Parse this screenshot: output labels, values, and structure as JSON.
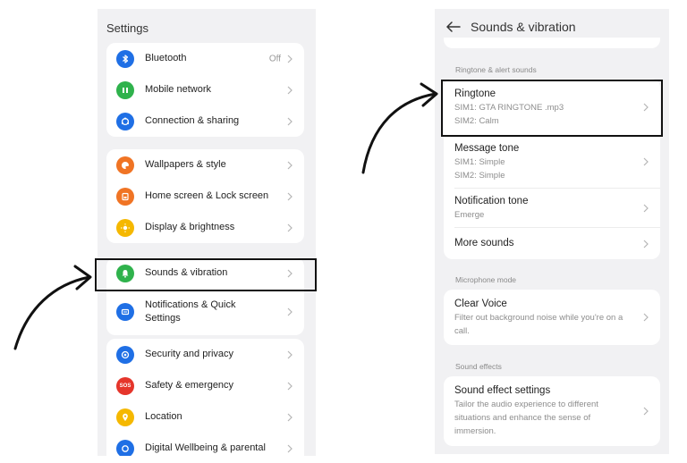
{
  "left": {
    "title": "Settings",
    "groups": [
      [
        {
          "label": "Bluetooth",
          "value": "Off",
          "icon": "bluetooth-icon",
          "color": "#1f6fe5"
        },
        {
          "label": "Mobile network",
          "icon": "signal-icon",
          "color": "#2fb24c"
        },
        {
          "label": "Connection & sharing",
          "icon": "sharing-icon",
          "color": "#1f6fe5"
        }
      ],
      [
        {
          "label": "Wallpapers & style",
          "icon": "palette-icon",
          "color": "#f07424"
        },
        {
          "label": "Home screen & Lock screen",
          "icon": "home-screen-icon",
          "color": "#f07424"
        },
        {
          "label": "Display & brightness",
          "icon": "sun-icon",
          "color": "#f5b800"
        }
      ],
      [
        {
          "label": "Sounds & vibration",
          "icon": "bell-icon",
          "color": "#2fb24c"
        },
        {
          "label": "Notifications & Quick Settings",
          "icon": "notification-icon",
          "color": "#1f6fe5"
        }
      ],
      [
        {
          "label": "Security and privacy",
          "icon": "security-icon",
          "color": "#1f6fe5"
        },
        {
          "label": "Safety & emergency",
          "icon": "sos-icon",
          "color": "#e5352b",
          "text": "SOS"
        },
        {
          "label": "Location",
          "icon": "location-pin-icon",
          "color": "#f5b800"
        },
        {
          "label": "Digital Wellbeing & parental",
          "icon": "wellbeing-icon",
          "color": "#1f6fe5"
        }
      ]
    ]
  },
  "right": {
    "title": "Sounds & vibration",
    "sections": {
      "ringtone_label": "Ringtone & alert sounds",
      "mic_label": "Microphone mode",
      "effects_label": "Sound effects"
    },
    "ringtone": {
      "title": "Ringtone",
      "sim1": "SIM1:  GTA RINGTONE .mp3",
      "sim2": "SIM2:  Calm"
    },
    "message": {
      "title": "Message tone",
      "sim1": "SIM1:  Simple",
      "sim2": "SIM2:  Simple"
    },
    "notification": {
      "title": "Notification tone",
      "sub": "Emerge"
    },
    "more": {
      "title": "More sounds"
    },
    "clear_voice": {
      "title": "Clear Voice",
      "sub": "Filter out background noise while you're on a call."
    },
    "sound_effect": {
      "title": "Sound effect settings",
      "sub": "Tailor the audio experience to different situations and enhance the sense of immersion."
    }
  }
}
